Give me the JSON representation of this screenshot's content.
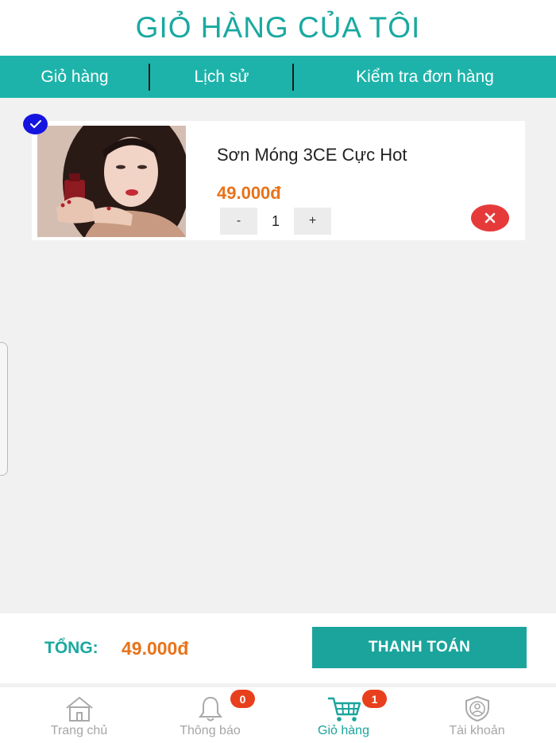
{
  "header": {
    "title": "GIỎ HÀNG CỦA TÔI"
  },
  "tabs": [
    {
      "label": "Giỏ hàng"
    },
    {
      "label": "Lịch sử"
    },
    {
      "label": "Kiểm tra đơn hàng"
    }
  ],
  "cart": {
    "items": [
      {
        "name": "Sơn Móng 3CE Cực Hot",
        "price": "49.000đ",
        "quantity": "1",
        "selected": true,
        "minus_label": "-",
        "plus_label": "+",
        "image": "product-photo"
      }
    ]
  },
  "summary": {
    "total_label": "TỔNG:",
    "total_value": "49.000đ",
    "checkout_label": "THANH TOÁN"
  },
  "bottom_nav": {
    "items": [
      {
        "label": "Trang chủ",
        "icon": "home-icon"
      },
      {
        "label": "Thông báo",
        "icon": "bell-icon",
        "badge": "0"
      },
      {
        "label": "Giỏ hàng",
        "icon": "cart-icon",
        "badge": "1",
        "active": true
      },
      {
        "label": "Tài khoản",
        "icon": "account-icon"
      }
    ]
  },
  "colors": {
    "primary": "#1db3aa",
    "price": "#e8731a",
    "remove": "#e63a3a",
    "badge": "#e8401c",
    "check": "#1515e0"
  }
}
